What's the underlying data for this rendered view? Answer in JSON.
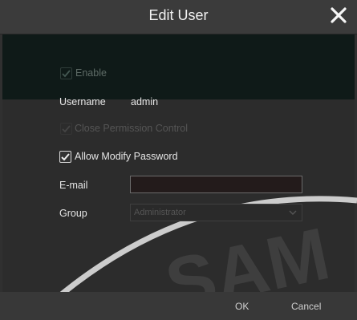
{
  "dialog": {
    "title": "Edit User"
  },
  "form": {
    "enable": {
      "label": "Enable",
      "checked": true,
      "disabled": true
    },
    "username": {
      "label": "Username",
      "value": "admin"
    },
    "close_permission": {
      "label": "Close Permission Control",
      "checked": true,
      "disabled": true
    },
    "allow_modify_password": {
      "label": "Allow Modify Password",
      "checked": true,
      "disabled": false
    },
    "email": {
      "label": "E-mail",
      "value": ""
    },
    "group": {
      "label": "Group",
      "selected": "Administrator"
    }
  },
  "buttons": {
    "ok": "OK",
    "cancel": "Cancel"
  },
  "watermark": {
    "text": "SAM"
  },
  "colors": {
    "background": "#303030",
    "dark_band": "#0f1a18",
    "accent": "#e6e6e6"
  }
}
